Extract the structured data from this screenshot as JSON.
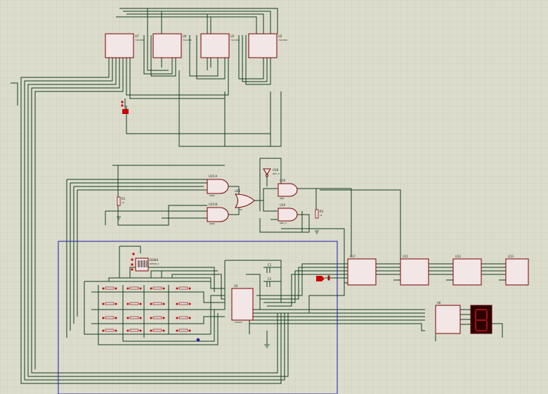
{
  "colors": {
    "background": "#dcdccc",
    "grid": "#c6c6b4",
    "wire": "#0f3d1f",
    "chip_fill": "#f2e6e6",
    "chip_border": "#7a0000",
    "label": "#1a1a1a",
    "accent_red": "#cc0000",
    "selection_box": "#1c1ca8",
    "seg_display": "#2a0000"
  },
  "components": {
    "u7": {
      "ref": "U7",
      "part": "74hc595"
    },
    "u4": {
      "ref": "U4",
      "part": "74hc595"
    },
    "u3": {
      "ref": "U3",
      "part": "74hc595"
    },
    "u2": {
      "ref": "U2",
      "part": "74hc595"
    },
    "u15a": {
      "ref": "U15:A",
      "part": "4082"
    },
    "u15b": {
      "ref": "U15:B",
      "part": "4082"
    },
    "u21": {
      "ref": "U21",
      "part": "OR"
    },
    "u16": {
      "ref": "U16",
      "part": "AND"
    },
    "u18": {
      "ref": "U18",
      "part": "NOT_2"
    },
    "u19": {
      "ref": "U19",
      "part": "AND_2"
    },
    "r1": {
      "ref": "R1",
      "value": "1k"
    },
    "r2": {
      "ref": "R2",
      "value": "1k"
    },
    "dsw4": {
      "ref": "DSW4",
      "part": "DIPSW_4"
    },
    "u5": {
      "ref": "U5",
      "part": "74C922"
    },
    "c1": {
      "ref": "C1"
    },
    "c2": {
      "ref": "C2"
    },
    "u17": {
      "ref": "U17"
    },
    "u11": {
      "ref": "U11"
    },
    "u12": {
      "ref": "U12"
    },
    "u13": {
      "ref": "U13"
    },
    "u6": {
      "ref": "U6"
    }
  }
}
